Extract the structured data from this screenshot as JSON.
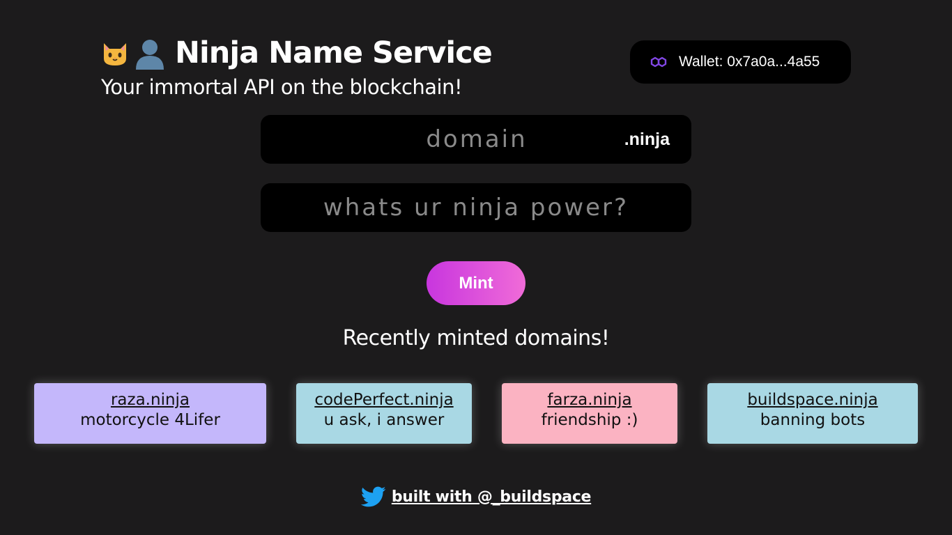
{
  "header": {
    "title": "Ninja Name Service",
    "subtitle": "Your immortal API on the blockchain!",
    "icons": [
      "cat-face-icon",
      "person-silhouette-icon"
    ]
  },
  "wallet": {
    "icon": "polygon-icon",
    "label": "Wallet: 0x7a0a...4a55",
    "accent_color": "#8247e5"
  },
  "form": {
    "domain_placeholder": "domain",
    "domain_value": "",
    "tld": ".ninja",
    "power_placeholder": "whats ur ninja power?",
    "power_value": "",
    "mint_label": "Mint",
    "mint_gradient": [
      "#c836de",
      "#f06bd8"
    ]
  },
  "recent": {
    "heading": "Recently minted domains!",
    "items": [
      {
        "domain": "raza.ninja",
        "record": "motorcycle 4Lifer",
        "color": "#c4b7fb"
      },
      {
        "domain": "codePerfect.ninja",
        "record": "u ask, i answer",
        "color": "#a9d8e4"
      },
      {
        "domain": "farza.ninja",
        "record": "friendship :)",
        "color": "#fbb3c2"
      },
      {
        "domain": "buildspace.ninja",
        "record": "banning bots",
        "color": "#a9d8e4"
      }
    ]
  },
  "footer": {
    "icon": "twitter-icon",
    "link_label": "built with @_buildspace",
    "icon_color": "#1da1f2"
  },
  "colors": {
    "background": "#1c1b1c",
    "panel": "#000000",
    "text": "#ffffff"
  }
}
